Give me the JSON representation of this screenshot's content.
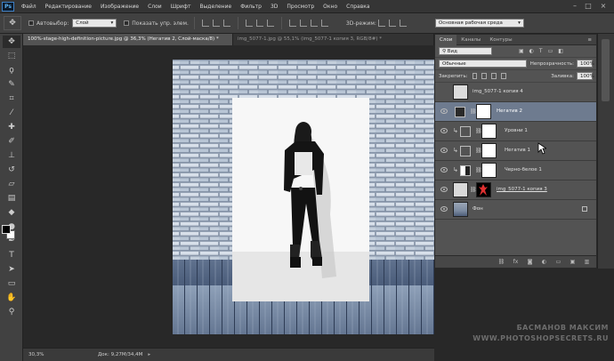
{
  "app": {
    "logo": "Ps"
  },
  "menu": [
    "Файл",
    "Редактирование",
    "Изображение",
    "Слои",
    "Шрифт",
    "Выделение",
    "Фильтр",
    "3D",
    "Просмотр",
    "Окно",
    "Справка"
  ],
  "options": {
    "autoselect_label": "Автовыбор:",
    "autoselect_value": "Слой",
    "show_transform_label": "Показать упр. элем.",
    "mode_3d_label": "3D-режим:",
    "workspace_value": "Основная рабочая среда"
  },
  "tabs": [
    "100%-stage-high-definition-picture.jpg @ 36,3% (Негатив 2, Слой-маска/8) *",
    "img_5077-1.jpg @ 55,1% (img_5077-1 копия 3, RGB/8#) *"
  ],
  "status": {
    "zoom": "30,3%",
    "doc": "Док: 9,27M/34,4M"
  },
  "panel": {
    "tabs": [
      "Слои",
      "Каналы",
      "Контуры"
    ],
    "filter_kind": "Вид",
    "blend_mode": "Обычные",
    "opacity_label": "Непрозрачность:",
    "opacity_value": "100%",
    "lock_label": "Закрепить:",
    "fill_label": "Заливка:",
    "fill_value": "100%",
    "layers": [
      {
        "name": "img_5077-1 копия 4"
      },
      {
        "name": "Негатив 2"
      },
      {
        "name": "Уровни 1"
      },
      {
        "name": "Негатив 1"
      },
      {
        "name": "Черно-белое 1"
      },
      {
        "name": "img_5077-1 копия 3"
      },
      {
        "name": "Фон"
      }
    ]
  },
  "watermark": {
    "line1": "БАСМАНОВ МАКСИМ",
    "line2": "WWW.PHOTOSHOPSECRETS.RU"
  },
  "colors": {
    "accent": "#3d7fc4",
    "selected_layer": "#6e7b8f",
    "background": "#282828"
  }
}
